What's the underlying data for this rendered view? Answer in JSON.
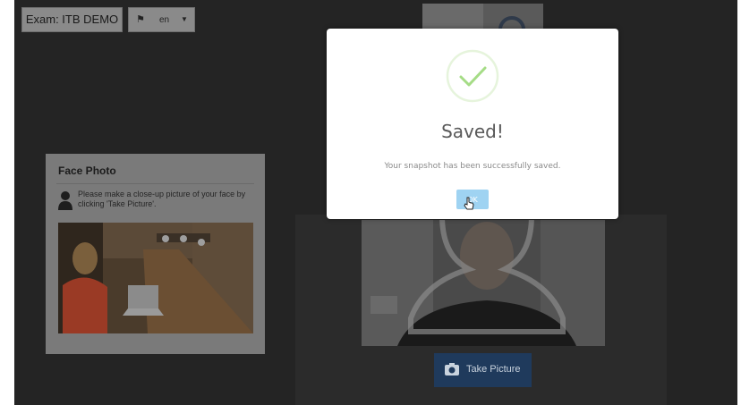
{
  "header": {
    "exam_label": "Exam: ITB DEMO",
    "language": "en"
  },
  "face_card": {
    "title": "Face Photo",
    "instruction": "Please make a close-up picture of your face by clicking 'Take Picture'."
  },
  "camera": {
    "take_picture_label": "Take Picture"
  },
  "modal": {
    "title": "Saved!",
    "message": "Your snapshot has been successfully saved.",
    "ok_label": "OK"
  },
  "colors": {
    "success_green": "#a5dc86",
    "ok_button": "#9fd3f2",
    "primary_button": "#1f3a5c"
  },
  "icons": [
    "flag-icon",
    "caret-down-icon",
    "user-icon",
    "camera-icon",
    "check-icon",
    "cursor-icon"
  ]
}
